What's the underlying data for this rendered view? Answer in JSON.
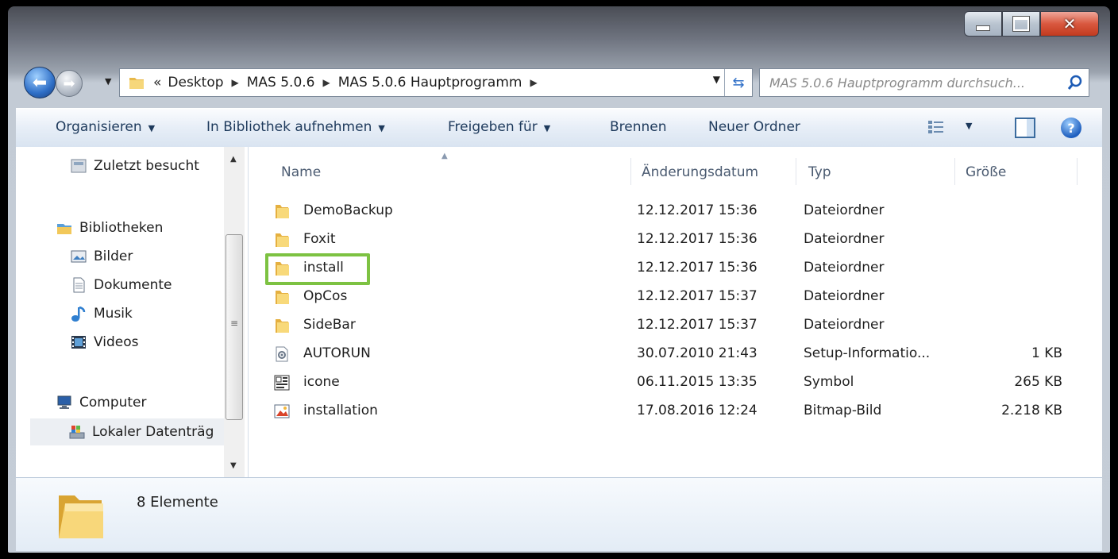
{
  "address_bar": {
    "overflow_glyph": "«",
    "crumbs": [
      "Desktop",
      "MAS 5.0.6",
      "MAS 5.0.6 Hauptprogramm"
    ],
    "refresh_icon": "refresh-icon"
  },
  "search": {
    "placeholder": "MAS 5.0.6 Hauptprogramm durchsuch..."
  },
  "toolbar": {
    "organize": "Organisieren",
    "library": "In Bibliothek aufnehmen",
    "share": "Freigeben für",
    "burn": "Brennen",
    "new_folder": "Neuer Ordner"
  },
  "nav": {
    "recent": "Zuletzt besucht",
    "libraries": "Bibliotheken",
    "pictures": "Bilder",
    "documents": "Dokumente",
    "music": "Musik",
    "videos": "Videos",
    "computer": "Computer",
    "local_disk": "Lokaler Datenträg"
  },
  "columns": {
    "name": "Name",
    "date": "Änderungsdatum",
    "type": "Typ",
    "size": "Größe"
  },
  "files": [
    {
      "name": "DemoBackup",
      "date": "12.12.2017 15:36",
      "type": "Dateiordner",
      "size": "",
      "icon": "folder-icon"
    },
    {
      "name": "Foxit",
      "date": "12.12.2017 15:36",
      "type": "Dateiordner",
      "size": "",
      "icon": "folder-icon"
    },
    {
      "name": "install",
      "date": "12.12.2017 15:36",
      "type": "Dateiordner",
      "size": "",
      "icon": "folder-icon"
    },
    {
      "name": "OpCos",
      "date": "12.12.2017 15:37",
      "type": "Dateiordner",
      "size": "",
      "icon": "folder-icon"
    },
    {
      "name": "SideBar",
      "date": "12.12.2017 15:37",
      "type": "Dateiordner",
      "size": "",
      "icon": "folder-icon"
    },
    {
      "name": "AUTORUN",
      "date": "30.07.2010 21:43",
      "type": "Setup-Informatio...",
      "size": "1 KB",
      "icon": "setup-info-icon"
    },
    {
      "name": "icone",
      "date": "06.11.2015 13:35",
      "type": "Symbol",
      "size": "265 KB",
      "icon": "symbol-file-icon"
    },
    {
      "name": "installation",
      "date": "17.08.2016 12:24",
      "type": "Bitmap-Bild",
      "size": "2.218 KB",
      "icon": "bitmap-file-icon"
    }
  ],
  "highlighted_item": "install",
  "highlight_color": "#7dc242",
  "status": {
    "count": "8 Elemente"
  }
}
